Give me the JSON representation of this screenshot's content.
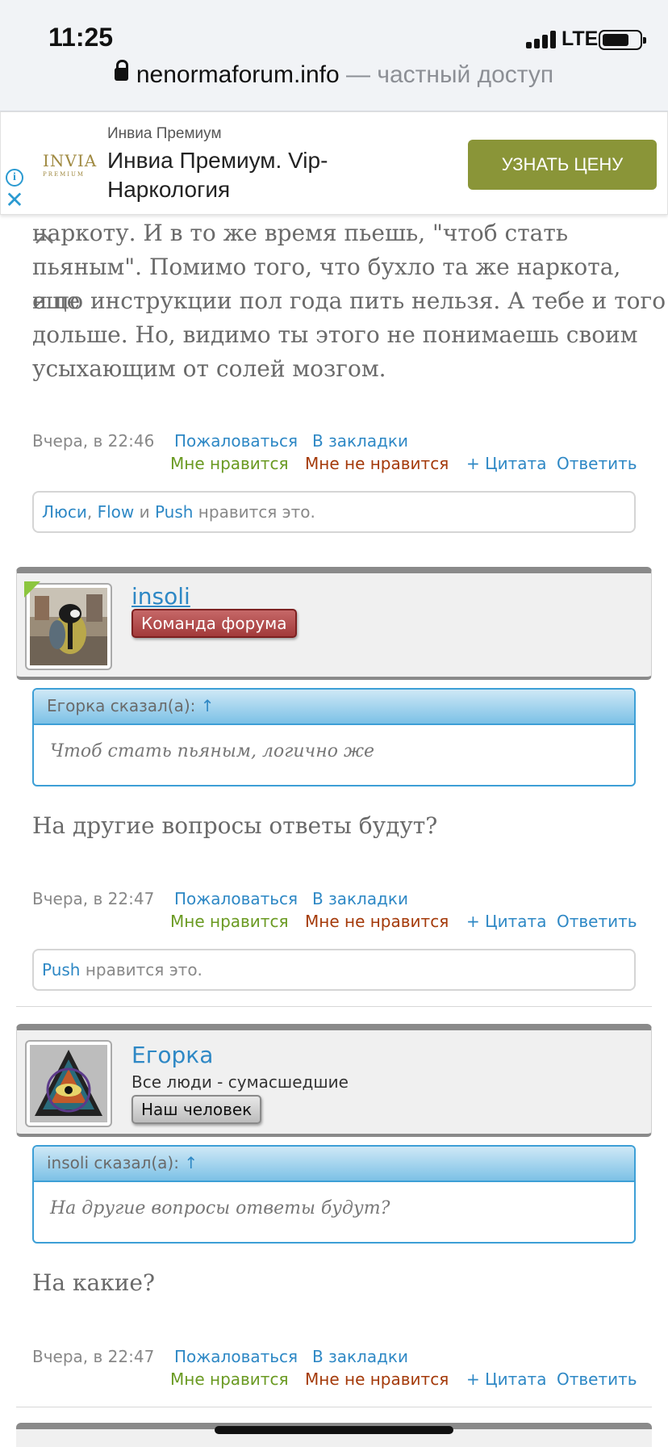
{
  "status": {
    "time": "11:25",
    "network": "LTE"
  },
  "browser": {
    "host": "nenormaforum.info",
    "separator": " — ",
    "access": "частный доступ"
  },
  "ad": {
    "logo": "INVIA",
    "logo_sub": "PREMIUM",
    "source": "Инвиа Премиум",
    "title": "Инвиа Премиум. Vip-Наркология",
    "cta": "УЗНАТЬ ЦЕНУ"
  },
  "post1": {
    "lines": [
      "наркоту. И в то же время пьешь, \"чтоб стать",
      "пьяным\". Помимо того, что бухло та же наркота, еще",
      "и по инструкции пол года пить нельзя. А тебе и того",
      "дольше. Но, видимо ты этого не понимаешь своим",
      "усыхающим от солей мозгом."
    ],
    "date": "Вчера, в 22:46",
    "likes": {
      "u1": "Люси",
      "sep": ", ",
      "u2": "Flow",
      "and": " и ",
      "u3": "Push",
      "suffix": " нравится это."
    }
  },
  "actions": {
    "report": "Пожаловаться",
    "bookmark": "В закладки",
    "like": "Мне нравится",
    "dislike": "Мне не нравится",
    "quote": "+ Цитата",
    "reply": "Ответить"
  },
  "post2": {
    "username": "insoli",
    "badge": "Команда форума",
    "quote_author": "Егорка сказал(а):",
    "quote_arrow": "↑",
    "quote_text": "Чтоб стать пьяным, логично же",
    "text": "На другие вопросы ответы будут?",
    "date": "Вчера, в 22:47",
    "likes": {
      "u1": "Push",
      "suffix": " нравится это."
    }
  },
  "post3": {
    "username": "Егорка",
    "title": "Все люди - сумасшедшие",
    "badge": "Наш человек",
    "quote_author": "insoli сказал(а):",
    "quote_arrow": "↑",
    "quote_text": "На другие вопросы ответы будут?",
    "text": "На какие?",
    "date": "Вчера, в 22:47"
  },
  "colors": {
    "link": "#2e88c5",
    "like": "#6a9a22",
    "dislike": "#a43a0a",
    "ad_button": "#8a9538"
  }
}
